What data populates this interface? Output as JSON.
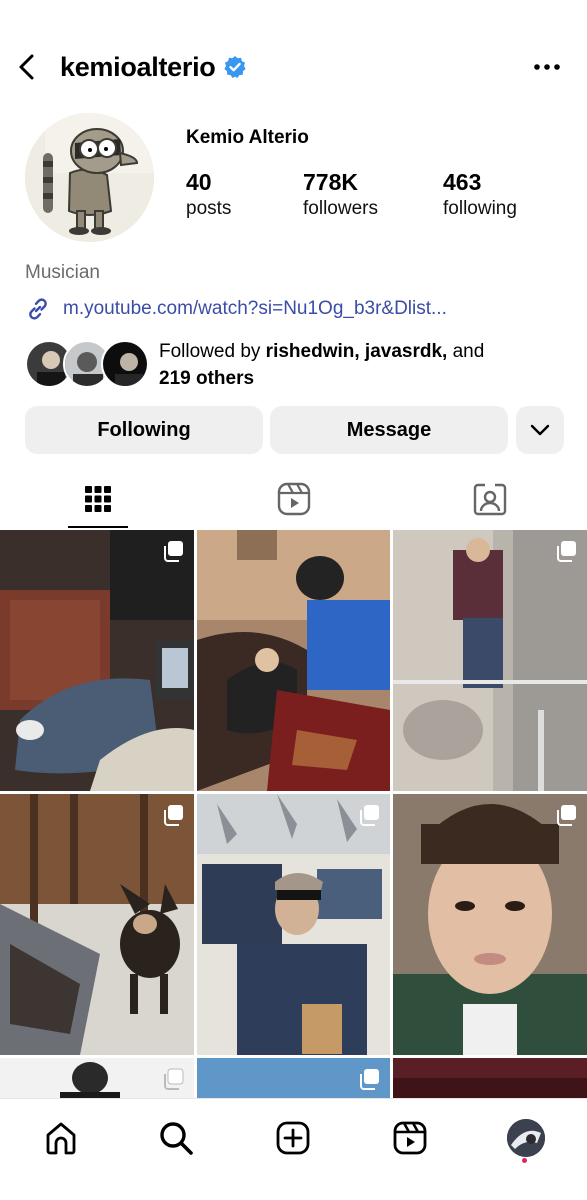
{
  "header": {
    "username": "kemioalterio",
    "verified": true,
    "icons": {
      "back": "chevron-left-icon",
      "more": "more-dots-icon"
    }
  },
  "profile": {
    "display_name": "Kemio Alterio",
    "stats": [
      {
        "value": "40",
        "label": "posts"
      },
      {
        "value": "778K",
        "label": "followers"
      },
      {
        "value": "463",
        "label": "following"
      }
    ],
    "category": "Musician",
    "link": "m.youtube.com/watch?si=Nu1Og_b3r&Dlist...",
    "followed_by": {
      "prefix": "Followed by",
      "names": "rishedwin, javasrdk,",
      "suffix": "and",
      "others": "219 others"
    }
  },
  "buttons": {
    "following": "Following",
    "message": "Message"
  },
  "tabs": [
    "grid-icon",
    "reels-icon",
    "tagged-icon"
  ],
  "nav": [
    "home-icon",
    "search-icon",
    "create-icon",
    "reels-icon",
    "profile-avatar"
  ],
  "colors": {
    "link": "#3b4ca8",
    "verified": "#3897f0",
    "button_bg": "#efefef",
    "notification_dot": "#e0245e"
  }
}
